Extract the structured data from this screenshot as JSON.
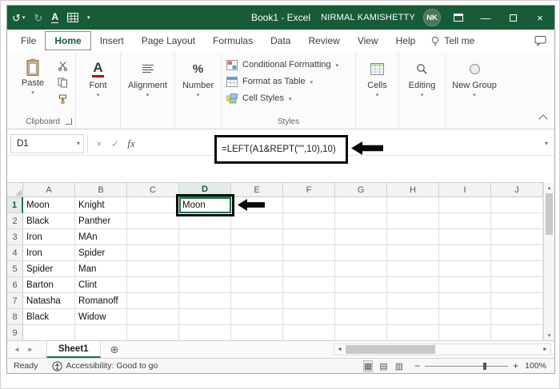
{
  "window": {
    "title": "Book1 - Excel",
    "user": "NIRMAL KAMISHETTY",
    "avatar": "NK"
  },
  "icons": {
    "undo": "↺",
    "redo": "↻",
    "underline_a": "A",
    "dropdown": "▾",
    "minimize": "—",
    "close": "×",
    "check": "✓",
    "cancel": "×",
    "tri_up": "▴",
    "tri_down": "▾",
    "tri_left": "◄",
    "tri_right": "►",
    "new_sheet": "⊕",
    "zoom_out": "−",
    "zoom_in": "+",
    "view_normal": "▦",
    "view_layout": "▤",
    "view_break": "▥"
  },
  "tabs": {
    "items": [
      "File",
      "Home",
      "Insert",
      "Page Layout",
      "Formulas",
      "Data",
      "Review",
      "View",
      "Help"
    ],
    "active_index": 1,
    "tell_me": "Tell me"
  },
  "ribbon": {
    "clipboard": {
      "paste": "Paste",
      "label": "Clipboard"
    },
    "font": {
      "label": "Font"
    },
    "alignment": {
      "label": "Alignment"
    },
    "number": {
      "label": "Number",
      "icon": "%"
    },
    "styles": {
      "items": [
        "Conditional Formatting",
        "Format as Table",
        "Cell Styles"
      ],
      "label": "Styles"
    },
    "cells": {
      "label": "Cells"
    },
    "editing": {
      "label": "Editing"
    },
    "new_group": {
      "label": "New Group"
    }
  },
  "formula_bar": {
    "name_box": "D1",
    "fx": "fx",
    "formula": "=LEFT(A1&REPT(\"\",10),10)"
  },
  "grid": {
    "columns": [
      "A",
      "B",
      "C",
      "D",
      "E",
      "F",
      "G",
      "H",
      "I",
      "J"
    ],
    "selected": {
      "column": "D",
      "row": 1
    },
    "rows": [
      {
        "n": 1,
        "cells": {
          "A": "Moon",
          "B": "Knight",
          "D": "Moon"
        }
      },
      {
        "n": 2,
        "cells": {
          "A": "Black",
          "B": "Panther"
        }
      },
      {
        "n": 3,
        "cells": {
          "A": "Iron",
          "B": "MAn"
        }
      },
      {
        "n": 4,
        "cells": {
          "A": "Iron",
          "B": "Spider"
        }
      },
      {
        "n": 5,
        "cells": {
          "A": "Spider",
          "B": "Man"
        }
      },
      {
        "n": 6,
        "cells": {
          "A": "Barton",
          "B": "Clint"
        }
      },
      {
        "n": 7,
        "cells": {
          "A": "Natasha",
          "B": "Romanoff"
        }
      },
      {
        "n": 8,
        "cells": {
          "A": "Black",
          "B": "Widow"
        }
      },
      {
        "n": 9,
        "cells": {}
      }
    ]
  },
  "sheet_bar": {
    "sheet": "Sheet1"
  },
  "status_bar": {
    "ready": "Ready",
    "accessibility": "Accessibility: Good to go",
    "zoom": "100%"
  },
  "colors": {
    "excel_green": "#217346",
    "titlebar_green": "#185c37",
    "annotation": "#0a0a0a"
  }
}
